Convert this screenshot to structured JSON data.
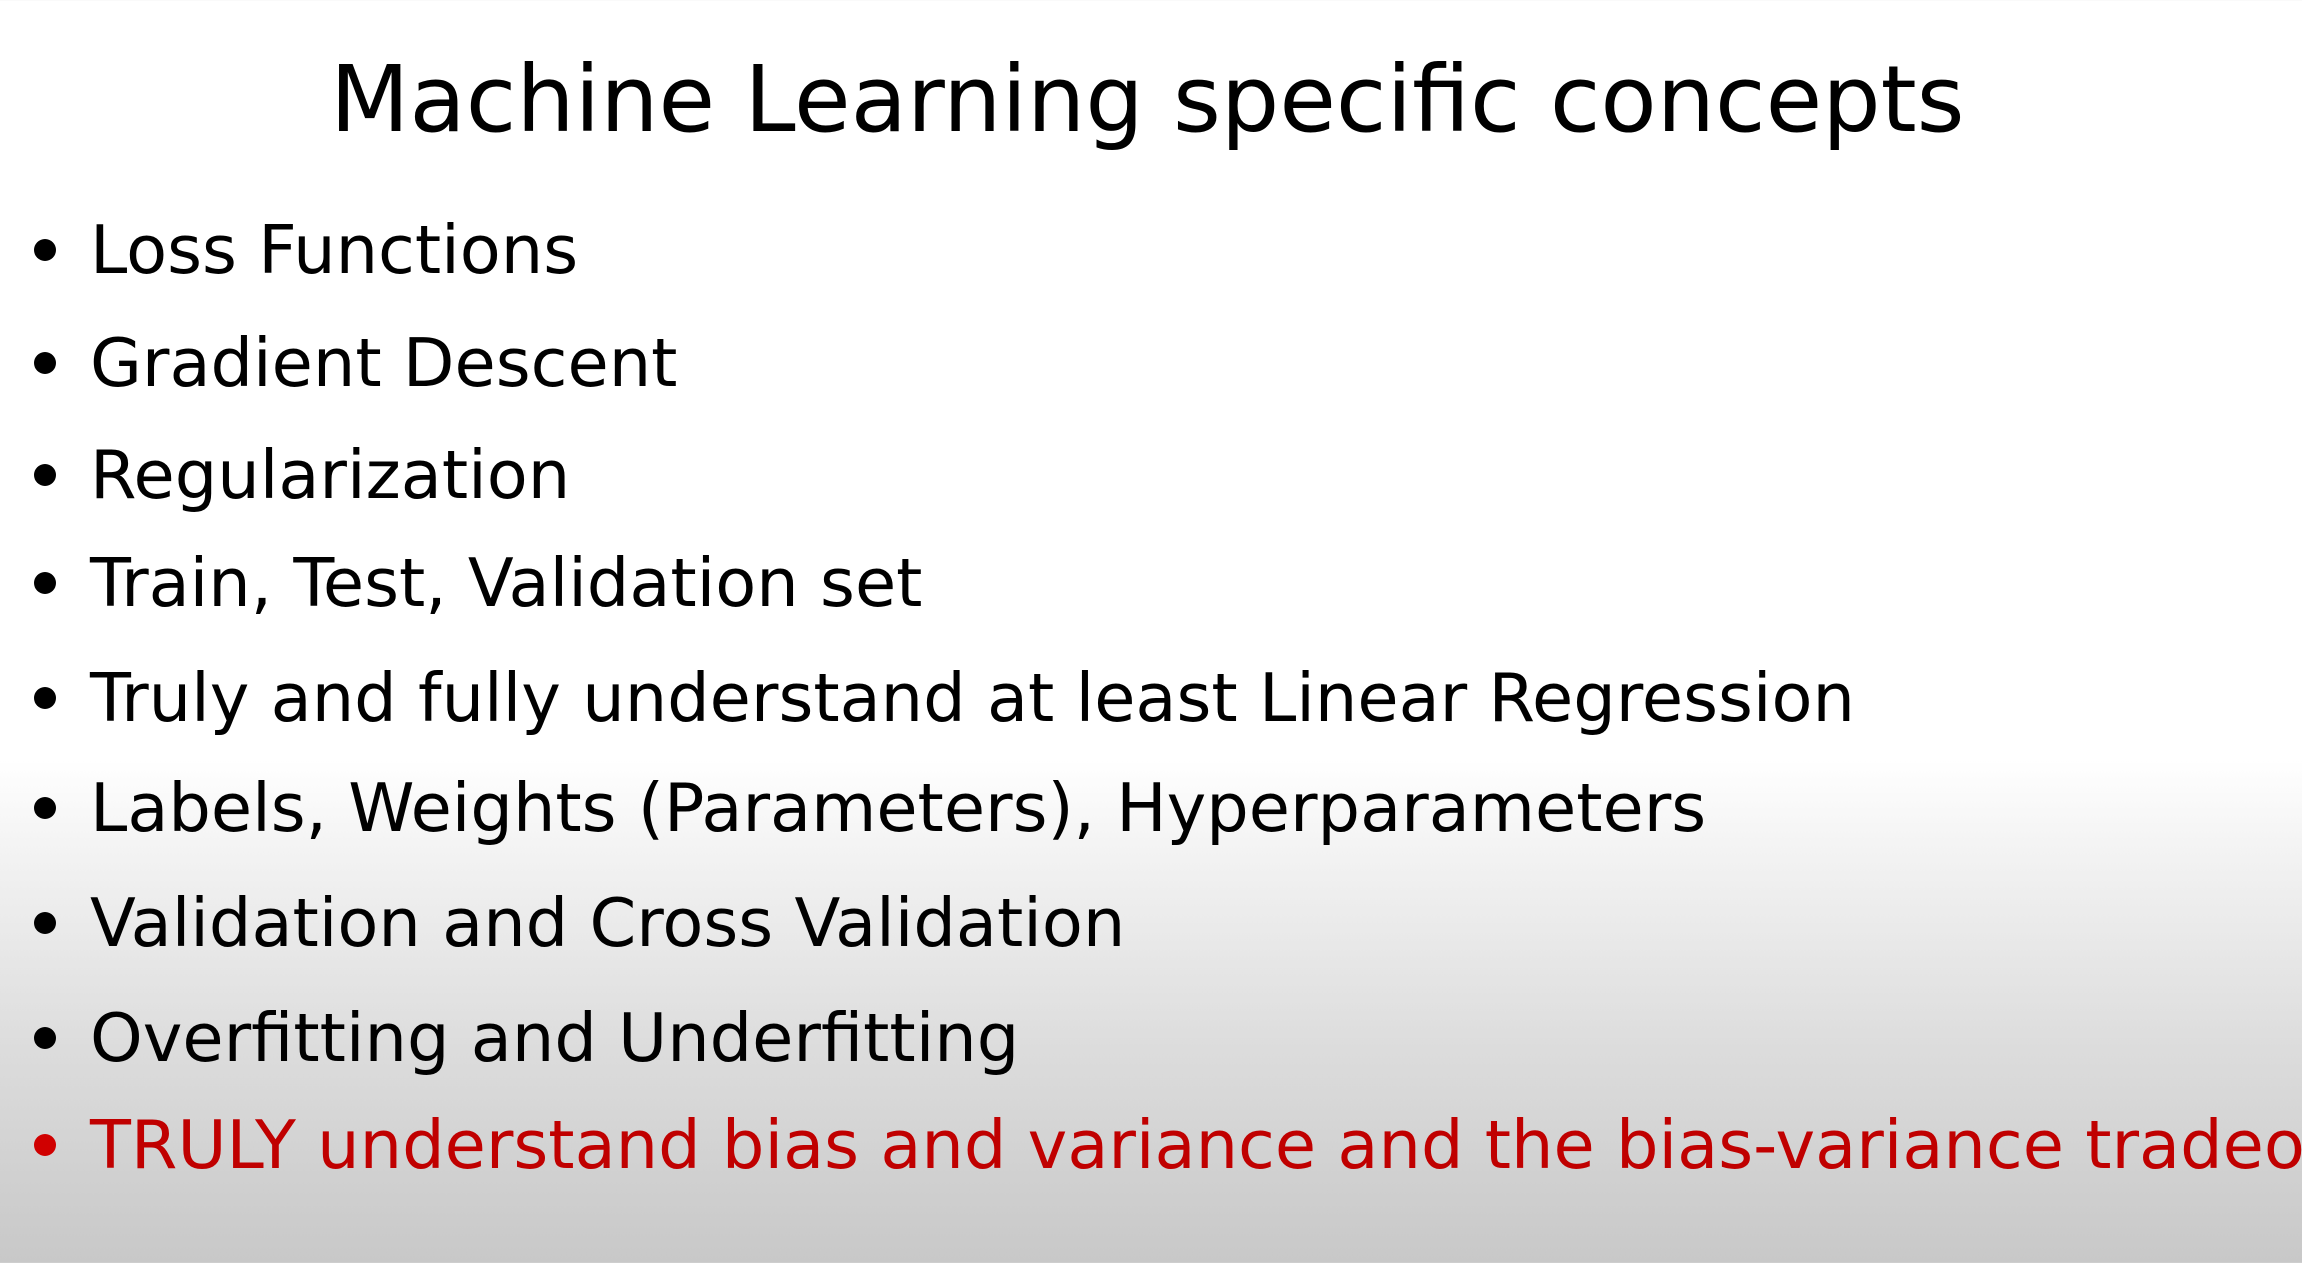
{
  "slide": {
    "title": "Machine Learning specific concepts",
    "bullets": [
      {
        "text": "Loss Functions",
        "highlight": false
      },
      {
        "text": "Gradient Descent",
        "highlight": false
      },
      {
        "text": "Regularization",
        "highlight": false
      },
      {
        "text": "Train, Test, Validation set",
        "highlight": false
      },
      {
        "text": "Truly and fully understand at least Linear Regression",
        "highlight": false
      },
      {
        "text": "Labels, Weights (Parameters), Hyperparameters",
        "highlight": false
      },
      {
        "text": "Validation and Cross Validation",
        "highlight": false
      },
      {
        "text": "Overfitting and Underfitting",
        "highlight": false
      },
      {
        "text": "TRULY understand bias and variance and the bias-variance tradeoff",
        "highlight": true
      }
    ]
  },
  "colors": {
    "text": "#000000",
    "highlight": "#c00000",
    "background_top": "#ffffff",
    "background_bottom": "#c8c8c8"
  }
}
